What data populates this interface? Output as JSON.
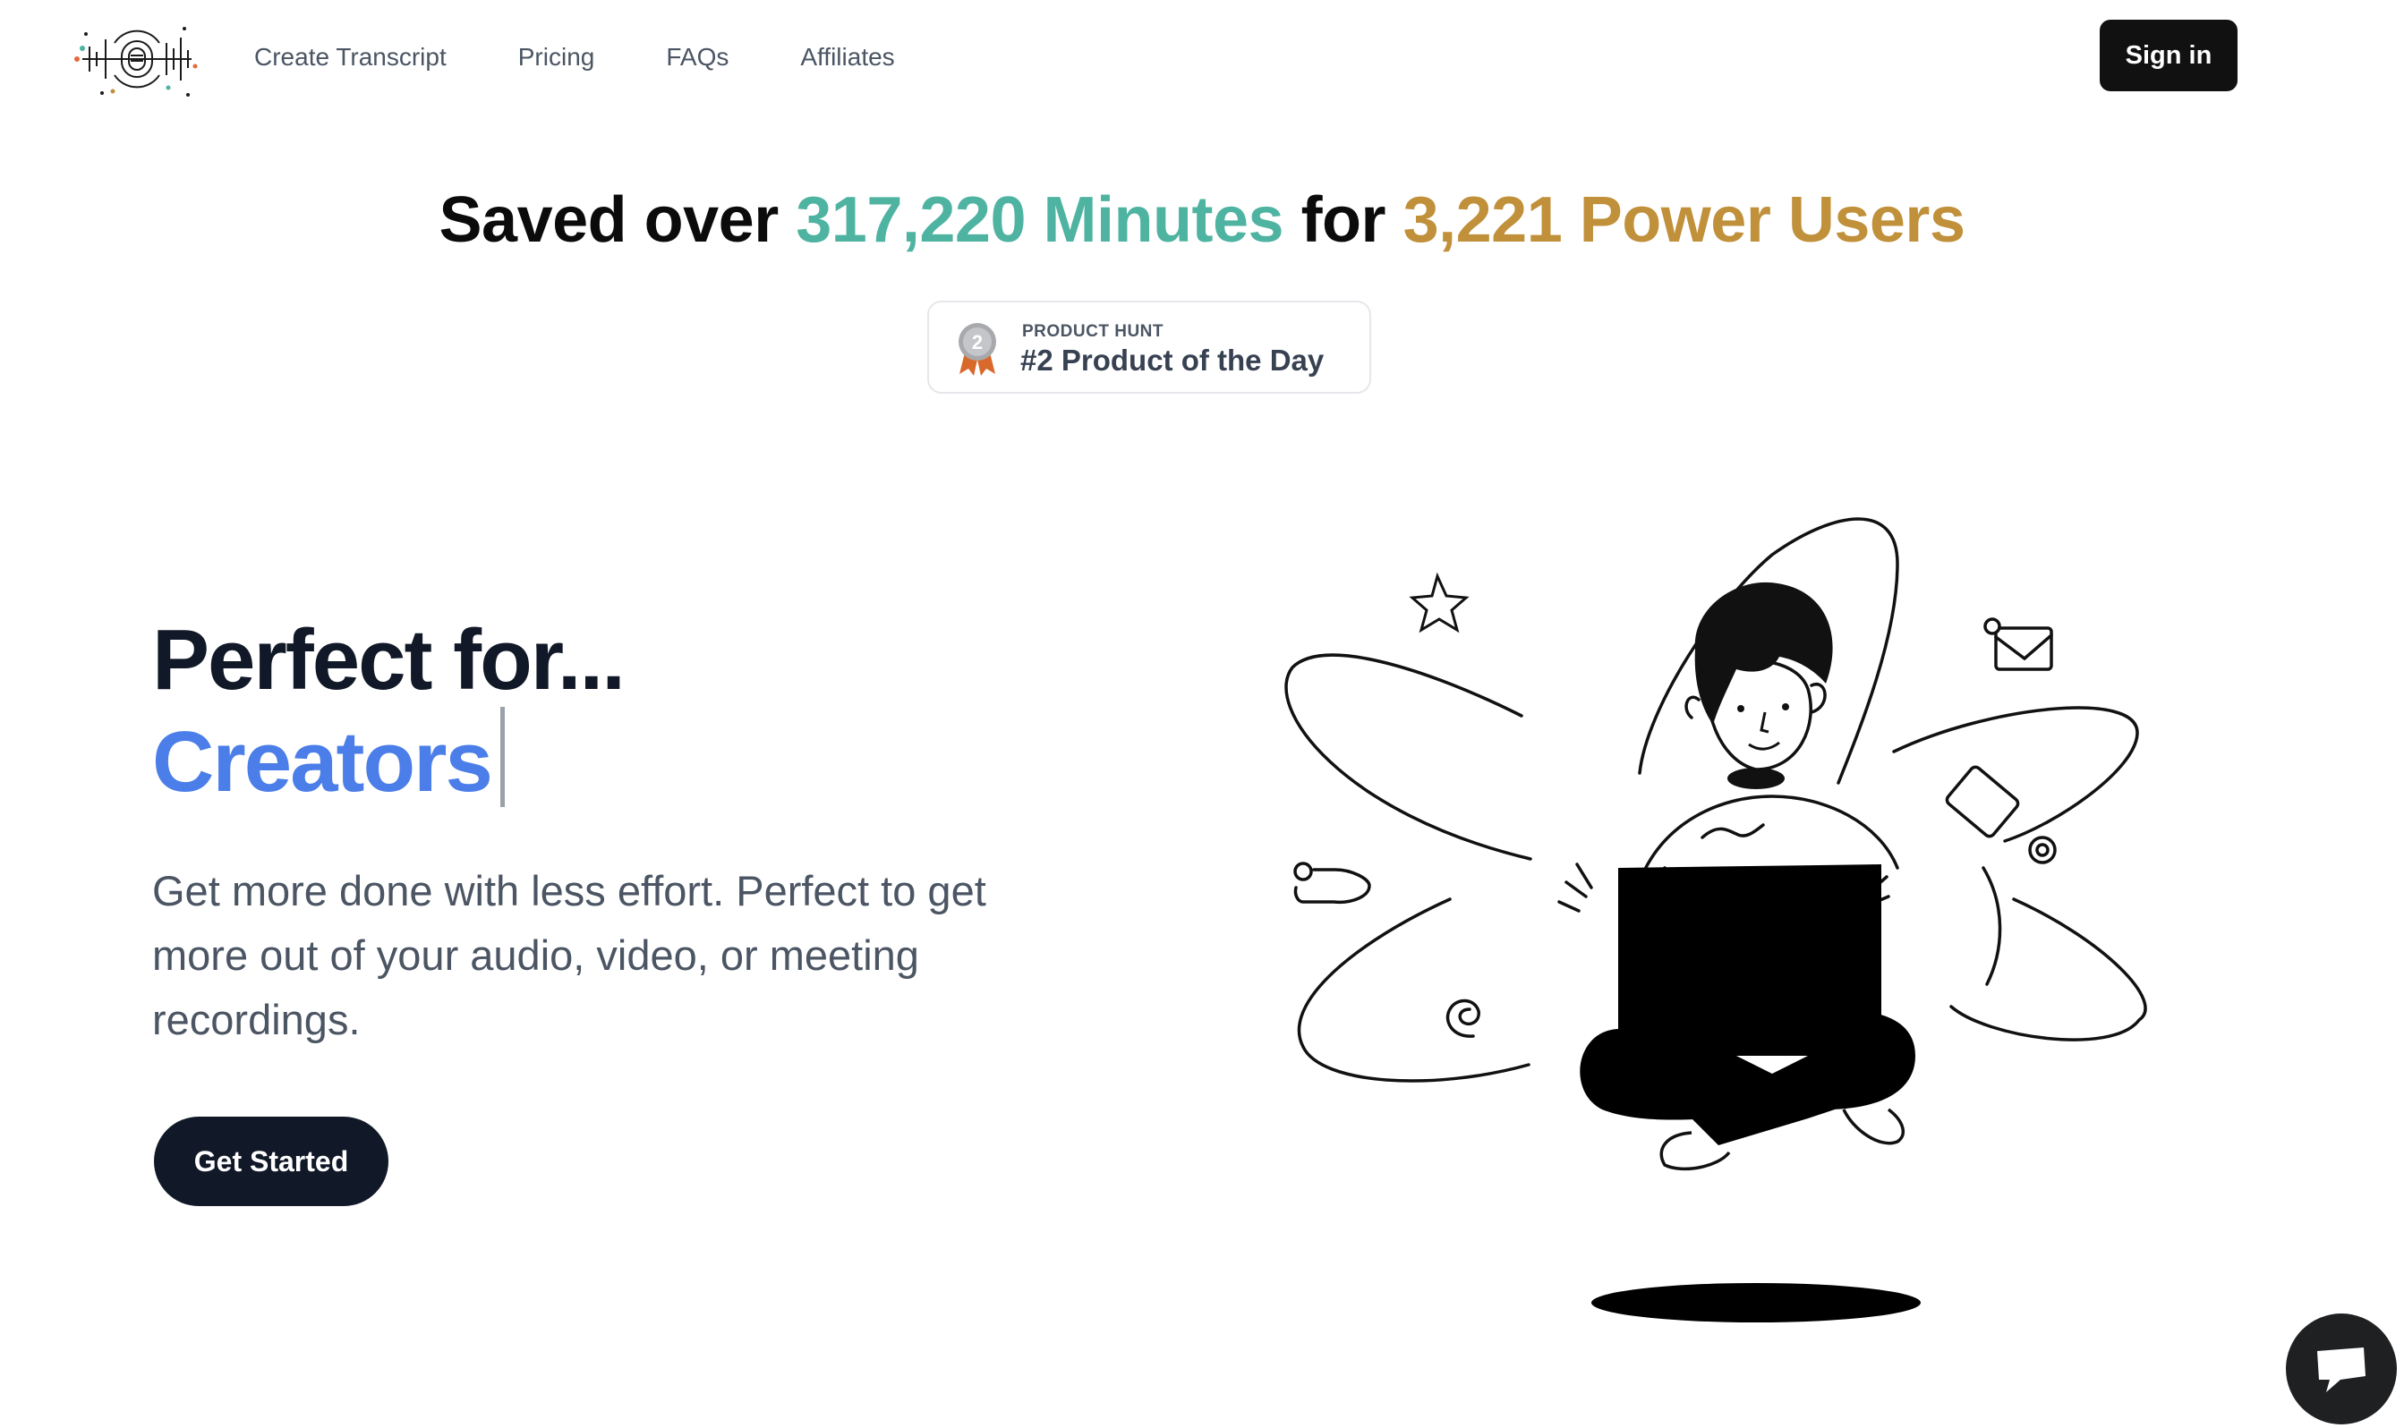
{
  "header": {
    "logo_alt": "logo",
    "nav": [
      {
        "label": "Create Transcript"
      },
      {
        "label": "Pricing"
      },
      {
        "label": "FAQs"
      },
      {
        "label": "Affiliates"
      }
    ],
    "sign_in_label": "Sign in"
  },
  "stats": {
    "prefix": "Saved over",
    "minutes_value": "317,220",
    "minutes_label": "Minutes",
    "middle": "for",
    "users_value": "3,221",
    "users_label": "Power Users",
    "colors": {
      "teal": "#4fb3a1",
      "gold": "#c0903a"
    }
  },
  "product_hunt": {
    "eyebrow": "PRODUCT HUNT",
    "title": "#2 Product of the Day",
    "medal_number": "2"
  },
  "hero": {
    "title": "Perfect for...",
    "rotating_word": "Creators",
    "description": "Get more done with less effort. Perfect to get more out of your audio, video, or meeting recordings.",
    "cta_label": "Get Started",
    "accent_color": "#4b7ee8"
  },
  "illustration": {
    "icon": "person-with-laptop-illustration"
  },
  "chat_widget": {
    "icon": "chat-icon"
  }
}
